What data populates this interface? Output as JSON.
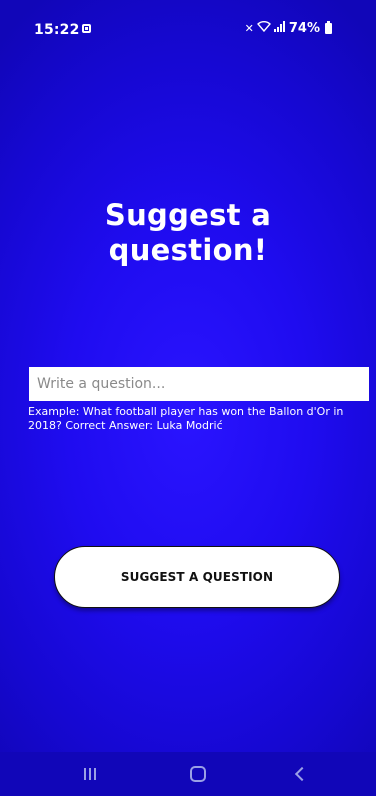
{
  "status_bar": {
    "time": "15:22",
    "battery": "74%",
    "icons": [
      "notification-icon",
      "mute-icon",
      "wifi-icon",
      "signal-icon",
      "battery-icon"
    ]
  },
  "main": {
    "title": "Suggest a\nquestion!",
    "input": {
      "placeholder": "Write a question...",
      "value": ""
    },
    "example": "Example: What football player has won the Ballon d'Or in 2018? Correct Answer: Luka Modrić",
    "button_label": "SUGGEST A QUESTION"
  },
  "nav_bar": {
    "icons": [
      "recent-apps-icon",
      "home-icon",
      "back-icon"
    ]
  },
  "colors": {
    "background": "#1f0cf0",
    "button_bg": "#ffffff",
    "text": "#ffffff"
  }
}
